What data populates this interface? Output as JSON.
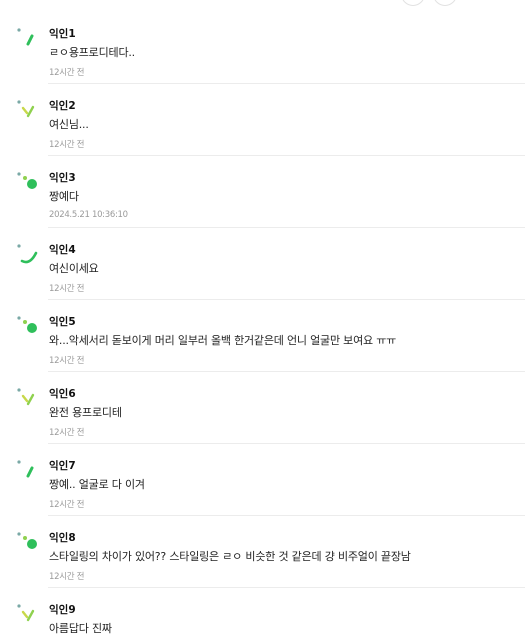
{
  "colors": {
    "accent_green": "#2fbf5b",
    "light_green": "#8fd14f",
    "dot_teal": "#7aa9a6"
  },
  "comments": [
    {
      "author": "익인1",
      "text": "ㄹㅇ용프로디테다..",
      "time": "12시간 전",
      "avatar": "slash-icon"
    },
    {
      "author": "익인2",
      "text": "여신님...",
      "time": "12시간 전",
      "avatar": "zigzag-icon"
    },
    {
      "author": "익인3",
      "text": "짱예다",
      "time": "2024.5.21 10:36:10",
      "avatar": "dot-icon"
    },
    {
      "author": "익인4",
      "text": "여신이세요",
      "time": "12시간 전",
      "avatar": "smile-curve-icon"
    },
    {
      "author": "익인5",
      "text": "와...악세서리 돋보이게 머리 일부러 올백 한거같은데 언니 얼굴만 보여요 ㅠㅠ",
      "time": "12시간 전",
      "avatar": "dot-icon"
    },
    {
      "author": "익인6",
      "text": "완전 용프로디테",
      "time": "12시간 전",
      "avatar": "zigzag-icon"
    },
    {
      "author": "익인7",
      "text": "짱예.. 얼굴로 다 이겨",
      "time": "12시간 전",
      "avatar": "slash-icon"
    },
    {
      "author": "익인8",
      "text": "스타일링의 차이가 있어?? 스타일링은 ㄹㅇ 비슷한 것 같은데 걍 비주얼이 끝장남",
      "time": "12시간 전",
      "avatar": "dot-icon"
    },
    {
      "author": "익인9",
      "text": "아름답다 진짜",
      "time": "",
      "avatar": "zigzag-icon"
    }
  ]
}
